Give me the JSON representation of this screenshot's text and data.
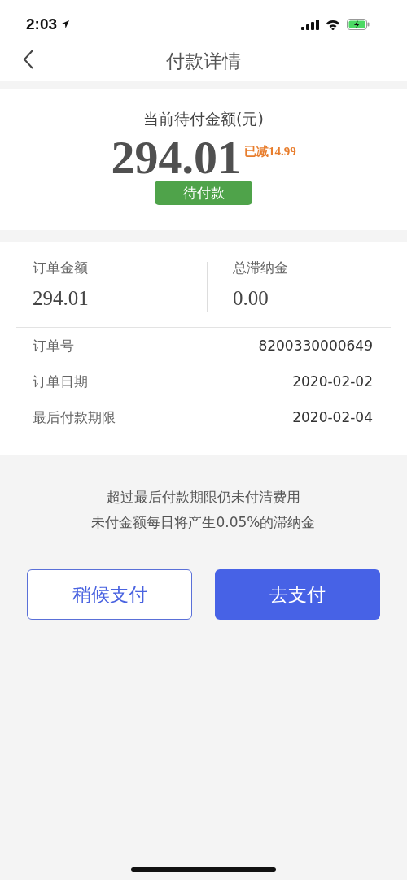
{
  "status_bar": {
    "time": "2:03"
  },
  "nav": {
    "title": "付款详情"
  },
  "summary": {
    "label": "当前待付金额(元)",
    "amount": "294.01",
    "discount": "已减14.99",
    "status": "待付款"
  },
  "metrics": [
    {
      "label": "订单金额",
      "value": "294.01"
    },
    {
      "label": "总滞纳金",
      "value": "0.00"
    }
  ],
  "details": [
    {
      "label": "订单号",
      "value": "8200330000649"
    },
    {
      "label": "订单日期",
      "value": "2020-02-02"
    },
    {
      "label": "最后付款期限",
      "value": "2020-02-04"
    }
  ],
  "notice": [
    "超过最后付款期限仍未付清费用",
    "未付金额每日将产生0.05%的滞纳金"
  ],
  "buttons": [
    {
      "label": "稍候支付",
      "kind": "secondary"
    },
    {
      "label": "去支付",
      "kind": "primary"
    }
  ]
}
